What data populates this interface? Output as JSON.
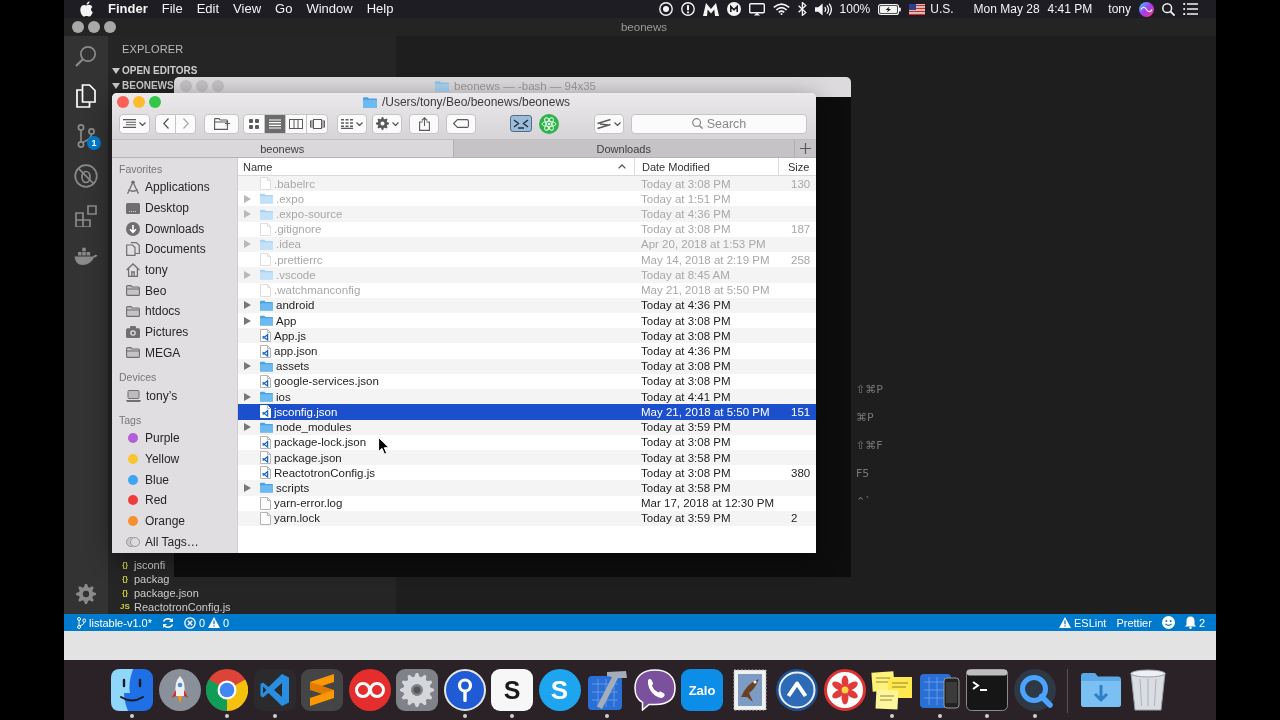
{
  "menu_bar": {
    "app": "Finder",
    "menus": [
      "File",
      "Edit",
      "View",
      "Go",
      "Window",
      "Help"
    ],
    "battery": "100%",
    "input_source": "U.S.",
    "date": "Mon May 28",
    "time": "4:41 PM",
    "user": "tony"
  },
  "vscode": {
    "title": "beonews",
    "activity_bar": [
      {
        "kind": "search",
        "selected": false
      },
      {
        "kind": "explorer",
        "selected": true
      },
      {
        "kind": "scm",
        "selected": false,
        "badge": "1"
      },
      {
        "kind": "debug",
        "selected": false
      },
      {
        "kind": "extensions",
        "selected": false
      },
      {
        "kind": "docker",
        "selected": false
      }
    ],
    "sidebar": {
      "title": "EXPLORER",
      "sections": [
        {
          "label": "OPEN EDITORS",
          "expanded": true
        },
        {
          "label": "BEONEWS",
          "expanded": true
        }
      ],
      "files": [
        {
          "glyph": "{}",
          "name": "jsconfi"
        },
        {
          "glyph": "{}",
          "name": "packag"
        },
        {
          "glyph": "{}",
          "name": "package.json"
        },
        {
          "glyph": "JS",
          "name": "ReactotronConfig.js"
        }
      ]
    },
    "editor_shortcuts": [
      "⇧⌘P",
      "⌘P",
      "⇧⌘F",
      "F5",
      "⌃`"
    ],
    "status_bar": {
      "branch": "listable-v1.0*",
      "errors": "0",
      "warnings": "0",
      "linter": "ESLint",
      "formatter": "Prettier",
      "notifications": "2"
    }
  },
  "terminal": {
    "title": "beonews — -bash — 94x35"
  },
  "finder": {
    "path": "/Users/tony/Beo/beonews/beonews",
    "view_modes": [
      {
        "kind": "icons",
        "selected": false
      },
      {
        "kind": "list",
        "selected": true
      },
      {
        "kind": "columns",
        "selected": false
      },
      {
        "kind": "gallery",
        "selected": false
      }
    ],
    "search": {
      "placeholder": "Search"
    },
    "tabs": [
      {
        "label": "beonews",
        "selected": true
      },
      {
        "label": "Downloads",
        "selected": false
      }
    ],
    "sidebar": [
      {
        "heading": "Favorites",
        "items": [
          {
            "label": "Applications",
            "kind": "applications"
          },
          {
            "label": "Desktop",
            "kind": "desktop"
          },
          {
            "label": "Downloads",
            "kind": "downloads"
          },
          {
            "label": "Documents",
            "kind": "documents"
          },
          {
            "label": "tony",
            "kind": "home"
          },
          {
            "label": "Beo",
            "kind": "folder"
          },
          {
            "label": "htdocs",
            "kind": "folder"
          },
          {
            "label": "Pictures",
            "kind": "pictures"
          },
          {
            "label": "MEGA",
            "kind": "folder"
          }
        ]
      },
      {
        "heading": "Devices",
        "items": [
          {
            "label": "tony’s",
            "kind": "laptop"
          }
        ]
      },
      {
        "heading": "Tags",
        "items": [
          {
            "label": "Purple",
            "kind": "tag",
            "color": "#b25fd7"
          },
          {
            "label": "Yellow",
            "kind": "tag",
            "color": "#f7c62f"
          },
          {
            "label": "Blue",
            "kind": "tag",
            "color": "#3da5f1"
          },
          {
            "label": "Red",
            "kind": "tag",
            "color": "#ee3c3c"
          },
          {
            "label": "Orange",
            "kind": "tag",
            "color": "#f5902e"
          },
          {
            "label": "All Tags…",
            "kind": "alltags"
          }
        ]
      }
    ],
    "columns": [
      {
        "label": "Name",
        "sorted": true
      },
      {
        "label": "Date Modified",
        "sorted": false
      },
      {
        "label": "Size",
        "sorted": false
      }
    ],
    "rows": [
      {
        "name": ".babelrc",
        "kind": "document",
        "date": "Today at 3:08 PM",
        "size": "130",
        "dimmed": true,
        "selected": false
      },
      {
        "name": ".expo",
        "kind": "folder",
        "date": "Today at 1:51 PM",
        "dimmed": true,
        "selected": false
      },
      {
        "name": ".expo-source",
        "kind": "folder",
        "date": "Today at 4:36 PM",
        "dimmed": true,
        "selected": false
      },
      {
        "name": ".gitignore",
        "kind": "document",
        "date": "Today at 3:08 PM",
        "size": "187",
        "dimmed": true,
        "selected": false
      },
      {
        "name": ".idea",
        "kind": "folder",
        "date": "Apr 20, 2018 at 1:53 PM",
        "dimmed": true,
        "selected": false
      },
      {
        "name": ".prettierrc",
        "kind": "document",
        "date": "May 14, 2018 at 2:19 PM",
        "size": "258",
        "dimmed": true,
        "selected": false
      },
      {
        "name": ".vscode",
        "kind": "folder",
        "date": "Today at 8:45 AM",
        "dimmed": true,
        "selected": false
      },
      {
        "name": ".watchmanconfig",
        "kind": "document",
        "date": "May 21, 2018 at 5:50 PM",
        "dimmed": true,
        "selected": false
      },
      {
        "name": "android",
        "kind": "folder",
        "date": "Today at 4:36 PM",
        "dimmed": false,
        "selected": false
      },
      {
        "name": "App",
        "kind": "folder",
        "date": "Today at 3:08 PM",
        "dimmed": false,
        "selected": false
      },
      {
        "name": "App.js",
        "kind": "code",
        "date": "Today at 3:08 PM",
        "dimmed": false,
        "selected": false
      },
      {
        "name": "app.json",
        "kind": "code",
        "date": "Today at 4:36 PM",
        "dimmed": false,
        "selected": false
      },
      {
        "name": "assets",
        "kind": "folder",
        "date": "Today at 3:08 PM",
        "dimmed": false,
        "selected": false
      },
      {
        "name": "google-services.json",
        "kind": "code",
        "date": "Today at 3:08 PM",
        "dimmed": false,
        "selected": false
      },
      {
        "name": "ios",
        "kind": "folder",
        "date": "Today at 4:41 PM",
        "dimmed": false,
        "selected": false
      },
      {
        "name": "jsconfig.json",
        "kind": "code",
        "date": "May 21, 2018 at 5:50 PM",
        "size": "151",
        "dimmed": false,
        "selected": true
      },
      {
        "name": "node_modules",
        "kind": "folder",
        "date": "Today at 3:59 PM",
        "dimmed": false,
        "selected": false
      },
      {
        "name": "package-lock.json",
        "kind": "code",
        "date": "Today at 3:08 PM",
        "dimmed": false,
        "selected": false
      },
      {
        "name": "package.json",
        "kind": "code",
        "date": "Today at 3:58 PM",
        "dimmed": false,
        "selected": false
      },
      {
        "name": "ReactotronConfig.js",
        "kind": "code",
        "date": "Today at 3:08 PM",
        "size": "380",
        "dimmed": false,
        "selected": false
      },
      {
        "name": "scripts",
        "kind": "folder",
        "date": "Today at 3:58 PM",
        "dimmed": false,
        "selected": false
      },
      {
        "name": "yarn-error.log",
        "kind": "document",
        "date": "Mar 17, 2018 at 12:30 PM",
        "dimmed": false,
        "selected": false
      },
      {
        "name": "yarn.lock",
        "kind": "document",
        "date": "Today at 3:59 PM",
        "size": "2",
        "dimmed": false,
        "selected": false
      }
    ]
  },
  "dock": {
    "apps": [
      {
        "kind": "finder",
        "running": true
      },
      {
        "kind": "launchpad",
        "running": false
      },
      {
        "kind": "chrome",
        "running": true
      },
      {
        "kind": "vscode",
        "running": true
      },
      {
        "kind": "sublime",
        "running": false
      },
      {
        "kind": "rings",
        "running": false
      },
      {
        "kind": "settings",
        "running": false
      },
      {
        "kind": "keyhole",
        "running": true
      },
      {
        "kind": "letter",
        "label": "S",
        "running": true
      },
      {
        "kind": "skype",
        "label": "S",
        "running": false
      },
      {
        "kind": "xcode",
        "running": true
      },
      {
        "kind": "viber",
        "running": false
      },
      {
        "kind": "zalo",
        "label": "Zalo",
        "running": false
      },
      {
        "kind": "mail",
        "running": false
      },
      {
        "kind": "chevron",
        "running": false
      },
      {
        "kind": "flower",
        "running": false
      },
      {
        "kind": "stickies",
        "running": true
      },
      {
        "kind": "simulator",
        "running": true
      },
      {
        "kind": "terminal",
        "running": true
      },
      {
        "kind": "quicktime",
        "running": true
      }
    ],
    "stacks": [
      {
        "kind": "downloads",
        "running": false
      },
      {
        "kind": "trash",
        "running": false
      }
    ]
  }
}
